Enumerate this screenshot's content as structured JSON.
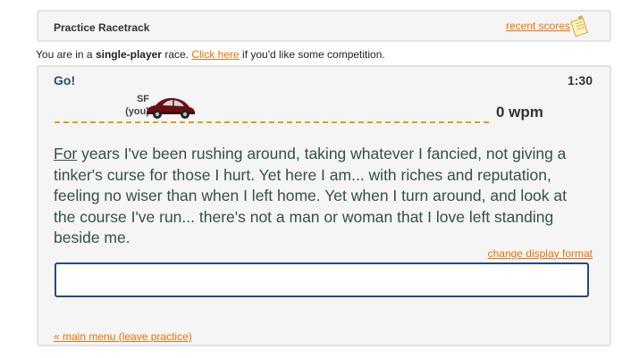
{
  "header": {
    "title": "Practice Racetrack",
    "recent_scores_label": "recent scores",
    "icon": "notepad-icon"
  },
  "status": {
    "prefix": "You are in a ",
    "mode": "single-player",
    "middle": " race. ",
    "link": "Click here",
    "suffix": " if you'd like some competition."
  },
  "race": {
    "go_label": "Go!",
    "timer": "1:30",
    "player": {
      "name": "SF",
      "tag": "(you)",
      "car_icon": "car-icon",
      "car_color": "#6b0f14"
    },
    "wpm": "0 wpm",
    "text": {
      "current_word": "For",
      "rest": " years I've been rushing around, taking whatever I fancied, not giving a tinker's curse for those I hurt. Yet here I am... with riches and reputation, feeling no wiser than when I left home. Yet when I turn around, and look at the course I've run... there's not a man or woman that I love left standing beside me."
    },
    "change_format_label": "change display format",
    "input_value": "",
    "main_menu_label": "« main menu (leave practice)"
  },
  "colors": {
    "link": "#e8700b",
    "accent": "#254a7a",
    "track": "#d7a21a"
  }
}
